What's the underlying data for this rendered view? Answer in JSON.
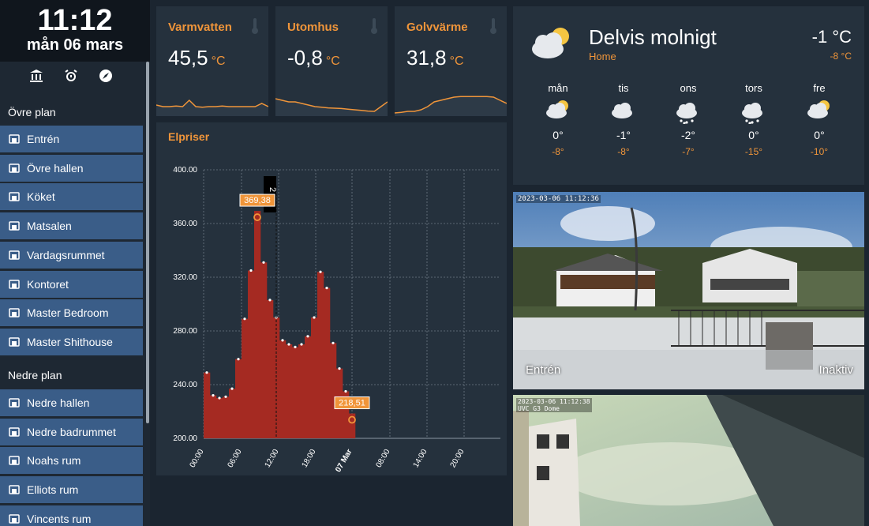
{
  "clock": {
    "time": "11:12",
    "date": "mån 06 mars"
  },
  "quick_icons": [
    "bank-icon",
    "alarm-icon",
    "compass-icon"
  ],
  "sidebar": {
    "upper_title": "Övre plan",
    "upper_items": [
      {
        "label": "Entrén",
        "icon": "door-icon"
      },
      {
        "label": "Övre hallen",
        "icon": "hallway-icon"
      },
      {
        "label": "Köket",
        "icon": "kitchen-icon"
      },
      {
        "label": "Matsalen",
        "icon": "dining-icon"
      },
      {
        "label": "Vardagsrummet",
        "icon": "sofa-icon"
      },
      {
        "label": "Kontoret",
        "icon": "desk-icon"
      },
      {
        "label": "Master Bedroom",
        "icon": "bed-icon"
      },
      {
        "label": "Master Shithouse",
        "icon": "bathtub-icon"
      }
    ],
    "lower_title": "Nedre plan",
    "lower_items": [
      {
        "label": "Nedre hallen",
        "icon": "stairs-icon"
      },
      {
        "label": "Nedre badrummet",
        "icon": "shower-icon"
      },
      {
        "label": "Noahs rum",
        "icon": "child-icon"
      },
      {
        "label": "Elliots rum",
        "icon": "child-icon"
      },
      {
        "label": "Vincents rum",
        "icon": "child-icon"
      }
    ]
  },
  "sensors": [
    {
      "label": "Varmvatten",
      "value": "45,5",
      "unit": "°C",
      "trend": [
        0.35,
        0.3,
        0.3,
        0.32,
        0.3,
        0.5,
        0.3,
        0.28,
        0.3,
        0.3,
        0.32,
        0.3,
        0.3,
        0.3,
        0.3,
        0.3,
        0.4,
        0.3
      ]
    },
    {
      "label": "Utomhus",
      "value": "-0,8",
      "unit": "°C",
      "trend": [
        0.55,
        0.5,
        0.45,
        0.45,
        0.4,
        0.35,
        0.3,
        0.28,
        0.26,
        0.25,
        0.24,
        0.22,
        0.2,
        0.18,
        0.16,
        0.15,
        0.3,
        0.45
      ]
    },
    {
      "label": "Golvvärme",
      "value": "31,8",
      "unit": "°C",
      "trend": [
        0.1,
        0.12,
        0.15,
        0.15,
        0.2,
        0.3,
        0.45,
        0.5,
        0.55,
        0.6,
        0.62,
        0.62,
        0.62,
        0.62,
        0.62,
        0.6,
        0.5,
        0.4
      ]
    }
  ],
  "elpriser": {
    "title": "Elpriser",
    "marker_max": "369,38",
    "marker_current": "218,51",
    "cursor_label": "2"
  },
  "chart_data": {
    "type": "area",
    "title": "Elpriser",
    "x_ticks": [
      "00:00",
      "06:00",
      "12:00",
      "18:00",
      "07 Mar",
      "08:00",
      "14:00",
      "20:00"
    ],
    "y_ticks": [
      "200.00",
      "240.00",
      "280.00",
      "320.00",
      "360.00",
      "400.00"
    ],
    "ylim": [
      200,
      400
    ],
    "hours": [
      0,
      1,
      2,
      3,
      4,
      5,
      6,
      7,
      8,
      9,
      10,
      11,
      12,
      13,
      14,
      15,
      16,
      17,
      18,
      19,
      20,
      21,
      22,
      23
    ],
    "values": [
      249,
      232,
      230,
      231,
      237,
      259,
      289,
      325,
      369.38,
      331,
      303,
      290,
      273,
      270,
      268,
      270,
      276,
      290,
      324,
      312,
      271,
      252,
      235,
      218.51
    ],
    "max_value": 369.38,
    "current_value": 218.51,
    "color": "#a52a22"
  },
  "weather": {
    "condition": "Delvis molnigt",
    "location": "Home",
    "temperature": "-1 °C",
    "low": "-8 °C",
    "forecast": [
      {
        "day": "mån",
        "hi": "0°",
        "lo": "-8°",
        "icon": "partly-cloudy-icon"
      },
      {
        "day": "tis",
        "hi": "-1°",
        "lo": "-8°",
        "icon": "cloudy-icon"
      },
      {
        "day": "ons",
        "hi": "-2°",
        "lo": "-7°",
        "icon": "snowy-icon"
      },
      {
        "day": "tors",
        "hi": "0°",
        "lo": "-15°",
        "icon": "snowy-icon"
      },
      {
        "day": "fre",
        "hi": "0°",
        "lo": "-10°",
        "icon": "partly-cloudy-icon"
      }
    ]
  },
  "cameras": [
    {
      "name": "Entrén",
      "state": "Inaktiv",
      "timestamp": "2023-03-06 11:12:36"
    },
    {
      "timestamp": "2023-03-06 11:12:38",
      "model": "UVC G3 Dome"
    }
  ],
  "colors": {
    "accent": "#f0953a",
    "nav": "#3a5d88",
    "card": "#25313d",
    "bar": "#a52a22"
  }
}
